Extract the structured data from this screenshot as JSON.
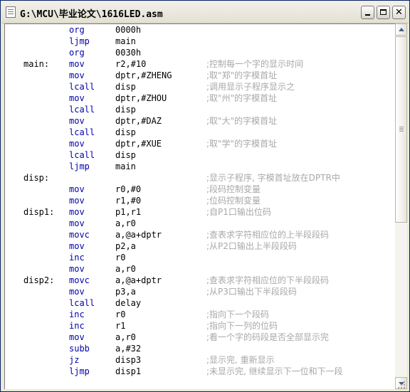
{
  "window": {
    "title": "G:\\MCU\\毕业论文\\1616LED.asm",
    "close_glyph": "✕"
  },
  "code": [
    {
      "label": "",
      "op": "org",
      "arg": "0000h",
      "comment": ""
    },
    {
      "label": "",
      "op": "ljmp",
      "arg": "main",
      "comment": ""
    },
    {
      "label": "",
      "op": "org",
      "arg": "0030h",
      "comment": ""
    },
    {
      "label": "main:",
      "op": "mov",
      "arg": "r2,#10",
      "comment": ";控制每一个字的显示时间"
    },
    {
      "label": "",
      "op": "mov",
      "arg": "dptr,#ZHENG",
      "comment": ";取\"郑\"的字模首址"
    },
    {
      "label": "",
      "op": "lcall",
      "arg": "disp",
      "comment": ";调用显示子程序显示之"
    },
    {
      "label": "",
      "op": "mov",
      "arg": "dptr,#ZHOU",
      "comment": ";取\"州\"的字模首址"
    },
    {
      "label": "",
      "op": "lcall",
      "arg": "disp",
      "comment": ""
    },
    {
      "label": "",
      "op": "mov",
      "arg": "dptr,#DAZ",
      "comment": ";取\"大\"的字模首址"
    },
    {
      "label": "",
      "op": "lcall",
      "arg": "disp",
      "comment": ""
    },
    {
      "label": "",
      "op": "mov",
      "arg": "dptr,#XUE",
      "comment": ";取\"学\"的字模首址"
    },
    {
      "label": "",
      "op": "lcall",
      "arg": "disp",
      "comment": ""
    },
    {
      "label": "",
      "op": "ljmp",
      "arg": "main",
      "comment": ""
    },
    {
      "label": "disp:",
      "op": "",
      "arg": "",
      "comment": ";显示子程序, 字模首址放在DPTR中"
    },
    {
      "label": "",
      "op": "mov",
      "arg": "r0,#0",
      "comment": ";段码控制变量"
    },
    {
      "label": "",
      "op": "mov",
      "arg": "r1,#0",
      "comment": ";位码控制变量"
    },
    {
      "label": "disp1:",
      "op": "mov",
      "arg": "p1,r1",
      "comment": ";自P1口输出位码"
    },
    {
      "label": "",
      "op": "mov",
      "arg": "a,r0",
      "comment": ""
    },
    {
      "label": "",
      "op": "movc",
      "arg": "a,@a+dptr",
      "comment": ";查表求字符相应位的上半段段码"
    },
    {
      "label": "",
      "op": "mov",
      "arg": "p2,a",
      "comment": ";从P2口输出上半段段码"
    },
    {
      "label": "",
      "op": "inc",
      "arg": "r0",
      "comment": ""
    },
    {
      "label": "",
      "op": "mov",
      "arg": "a,r0",
      "comment": ""
    },
    {
      "label": "disp2:",
      "op": "movc",
      "arg": "a,@a+dptr",
      "comment": ";查表求字符相应位的下半段段码"
    },
    {
      "label": "",
      "op": "mov",
      "arg": "p3,a",
      "comment": ";从P3口输出下半段段码"
    },
    {
      "label": "",
      "op": "lcall",
      "arg": "delay",
      "comment": ""
    },
    {
      "label": "",
      "op": "inc",
      "arg": "r0",
      "comment": ";指向下一个段码"
    },
    {
      "label": "",
      "op": "inc",
      "arg": "r1",
      "comment": ";指向下一列的位码"
    },
    {
      "label": "",
      "op": "mov",
      "arg": "a,r0",
      "comment": ";看一个字的码段是否全部显示完"
    },
    {
      "label": "",
      "op": "subb",
      "arg": "a,#32",
      "comment": ""
    },
    {
      "label": "",
      "op": "jz",
      "arg": "disp3",
      "comment": ";显示完, 重新显示"
    },
    {
      "label": "",
      "op": "ljmp",
      "arg": "disp1",
      "comment": ";未显示完, 继续显示下一位和下一段"
    }
  ]
}
